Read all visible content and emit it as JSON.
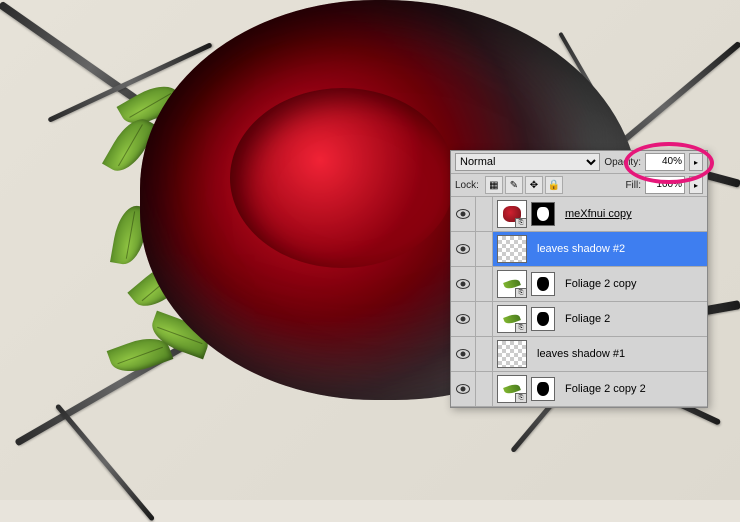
{
  "panel": {
    "blend_mode": "Normal",
    "opacity_label": "Opacity:",
    "opacity_value": "40%",
    "lock_label": "Lock:",
    "fill_label": "Fill:",
    "fill_value": "100%"
  },
  "layers": [
    {
      "name": "meXfnui copy",
      "selected": false,
      "has_mask": true,
      "mask_style": "black-bg white-shape",
      "thumb": "rose",
      "underline": true,
      "fx": true
    },
    {
      "name": "leaves shadow #2",
      "selected": true,
      "has_mask": false,
      "thumb": "checker",
      "underline": false,
      "fx": false
    },
    {
      "name": "Foliage 2 copy",
      "selected": false,
      "has_mask": true,
      "mask_style": "",
      "thumb": "leaf",
      "underline": false,
      "fx": true
    },
    {
      "name": "Foliage 2",
      "selected": false,
      "has_mask": true,
      "mask_style": "",
      "thumb": "leaf",
      "underline": false,
      "fx": true
    },
    {
      "name": "leaves shadow #1",
      "selected": false,
      "has_mask": false,
      "thumb": "checker",
      "underline": false,
      "fx": false
    },
    {
      "name": "Foliage 2 copy 2",
      "selected": false,
      "has_mask": true,
      "mask_style": "",
      "thumb": "leaf",
      "underline": false,
      "fx": true
    }
  ]
}
